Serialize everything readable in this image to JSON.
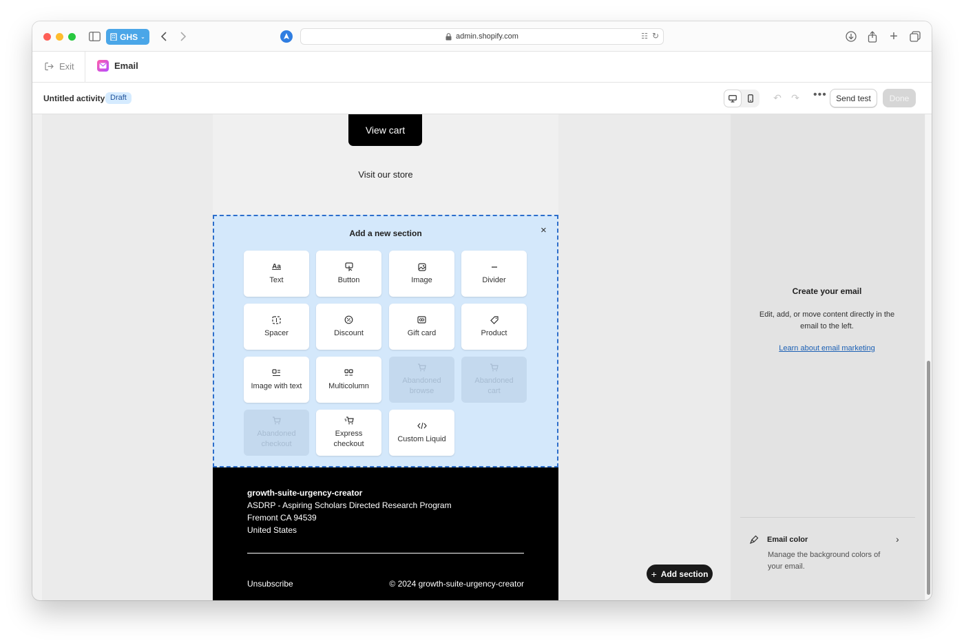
{
  "browser": {
    "profile_label": "GHS",
    "url": "admin.shopify.com"
  },
  "app": {
    "exit_label": "Exit",
    "title": "Email"
  },
  "toolbar": {
    "activity_name": "Untitled activity",
    "status_badge": "Draft",
    "send_test_label": "Send test",
    "done_label": "Done",
    "more_label": "•••"
  },
  "email": {
    "view_cart_label": "View cart",
    "visit_store_text": "Visit our store",
    "add_section_panel": {
      "title": "Add a new section",
      "close_label": "×",
      "tiles": [
        {
          "label": "Text",
          "icon": "text-icon",
          "enabled": true
        },
        {
          "label": "Button",
          "icon": "button-icon",
          "enabled": true
        },
        {
          "label": "Image",
          "icon": "image-icon",
          "enabled": true
        },
        {
          "label": "Divider",
          "icon": "divider-icon",
          "enabled": true
        },
        {
          "label": "Spacer",
          "icon": "spacer-icon",
          "enabled": true
        },
        {
          "label": "Discount",
          "icon": "discount-icon",
          "enabled": true
        },
        {
          "label": "Gift card",
          "icon": "gift-card-icon",
          "enabled": true
        },
        {
          "label": "Product",
          "icon": "product-tag-icon",
          "enabled": true
        },
        {
          "label": "Image with text",
          "icon": "image-with-text-icon",
          "enabled": true
        },
        {
          "label": "Multicolumn",
          "icon": "multicolumn-icon",
          "enabled": true
        },
        {
          "label": "Abandoned browse",
          "icon": "cart-icon",
          "enabled": false
        },
        {
          "label": "Abandoned cart",
          "icon": "cart-icon",
          "enabled": false
        },
        {
          "label": "Abandoned checkout",
          "icon": "cart-icon",
          "enabled": false
        },
        {
          "label": "Express checkout",
          "icon": "express-checkout-icon",
          "enabled": true
        },
        {
          "label": "Custom Liquid",
          "icon": "code-icon",
          "enabled": true
        }
      ]
    },
    "footer": {
      "shop_name": "growth-suite-urgency-creator",
      "address_lines": [
        "ASDRP - Aspiring Scholars Directed Research Program",
        "Fremont CA 94539",
        "United States"
      ],
      "unsubscribe_label": "Unsubscribe",
      "copyright": "© 2024 growth-suite-urgency-creator"
    }
  },
  "canvas": {
    "add_section_label": "Add section"
  },
  "sidebar": {
    "title": "Create your email",
    "description": "Edit, add, or move content directly in the email to the left.",
    "learn_link": "Learn about email marketing",
    "email_color_title": "Email color",
    "email_color_description": "Manage the background colors of your email."
  }
}
